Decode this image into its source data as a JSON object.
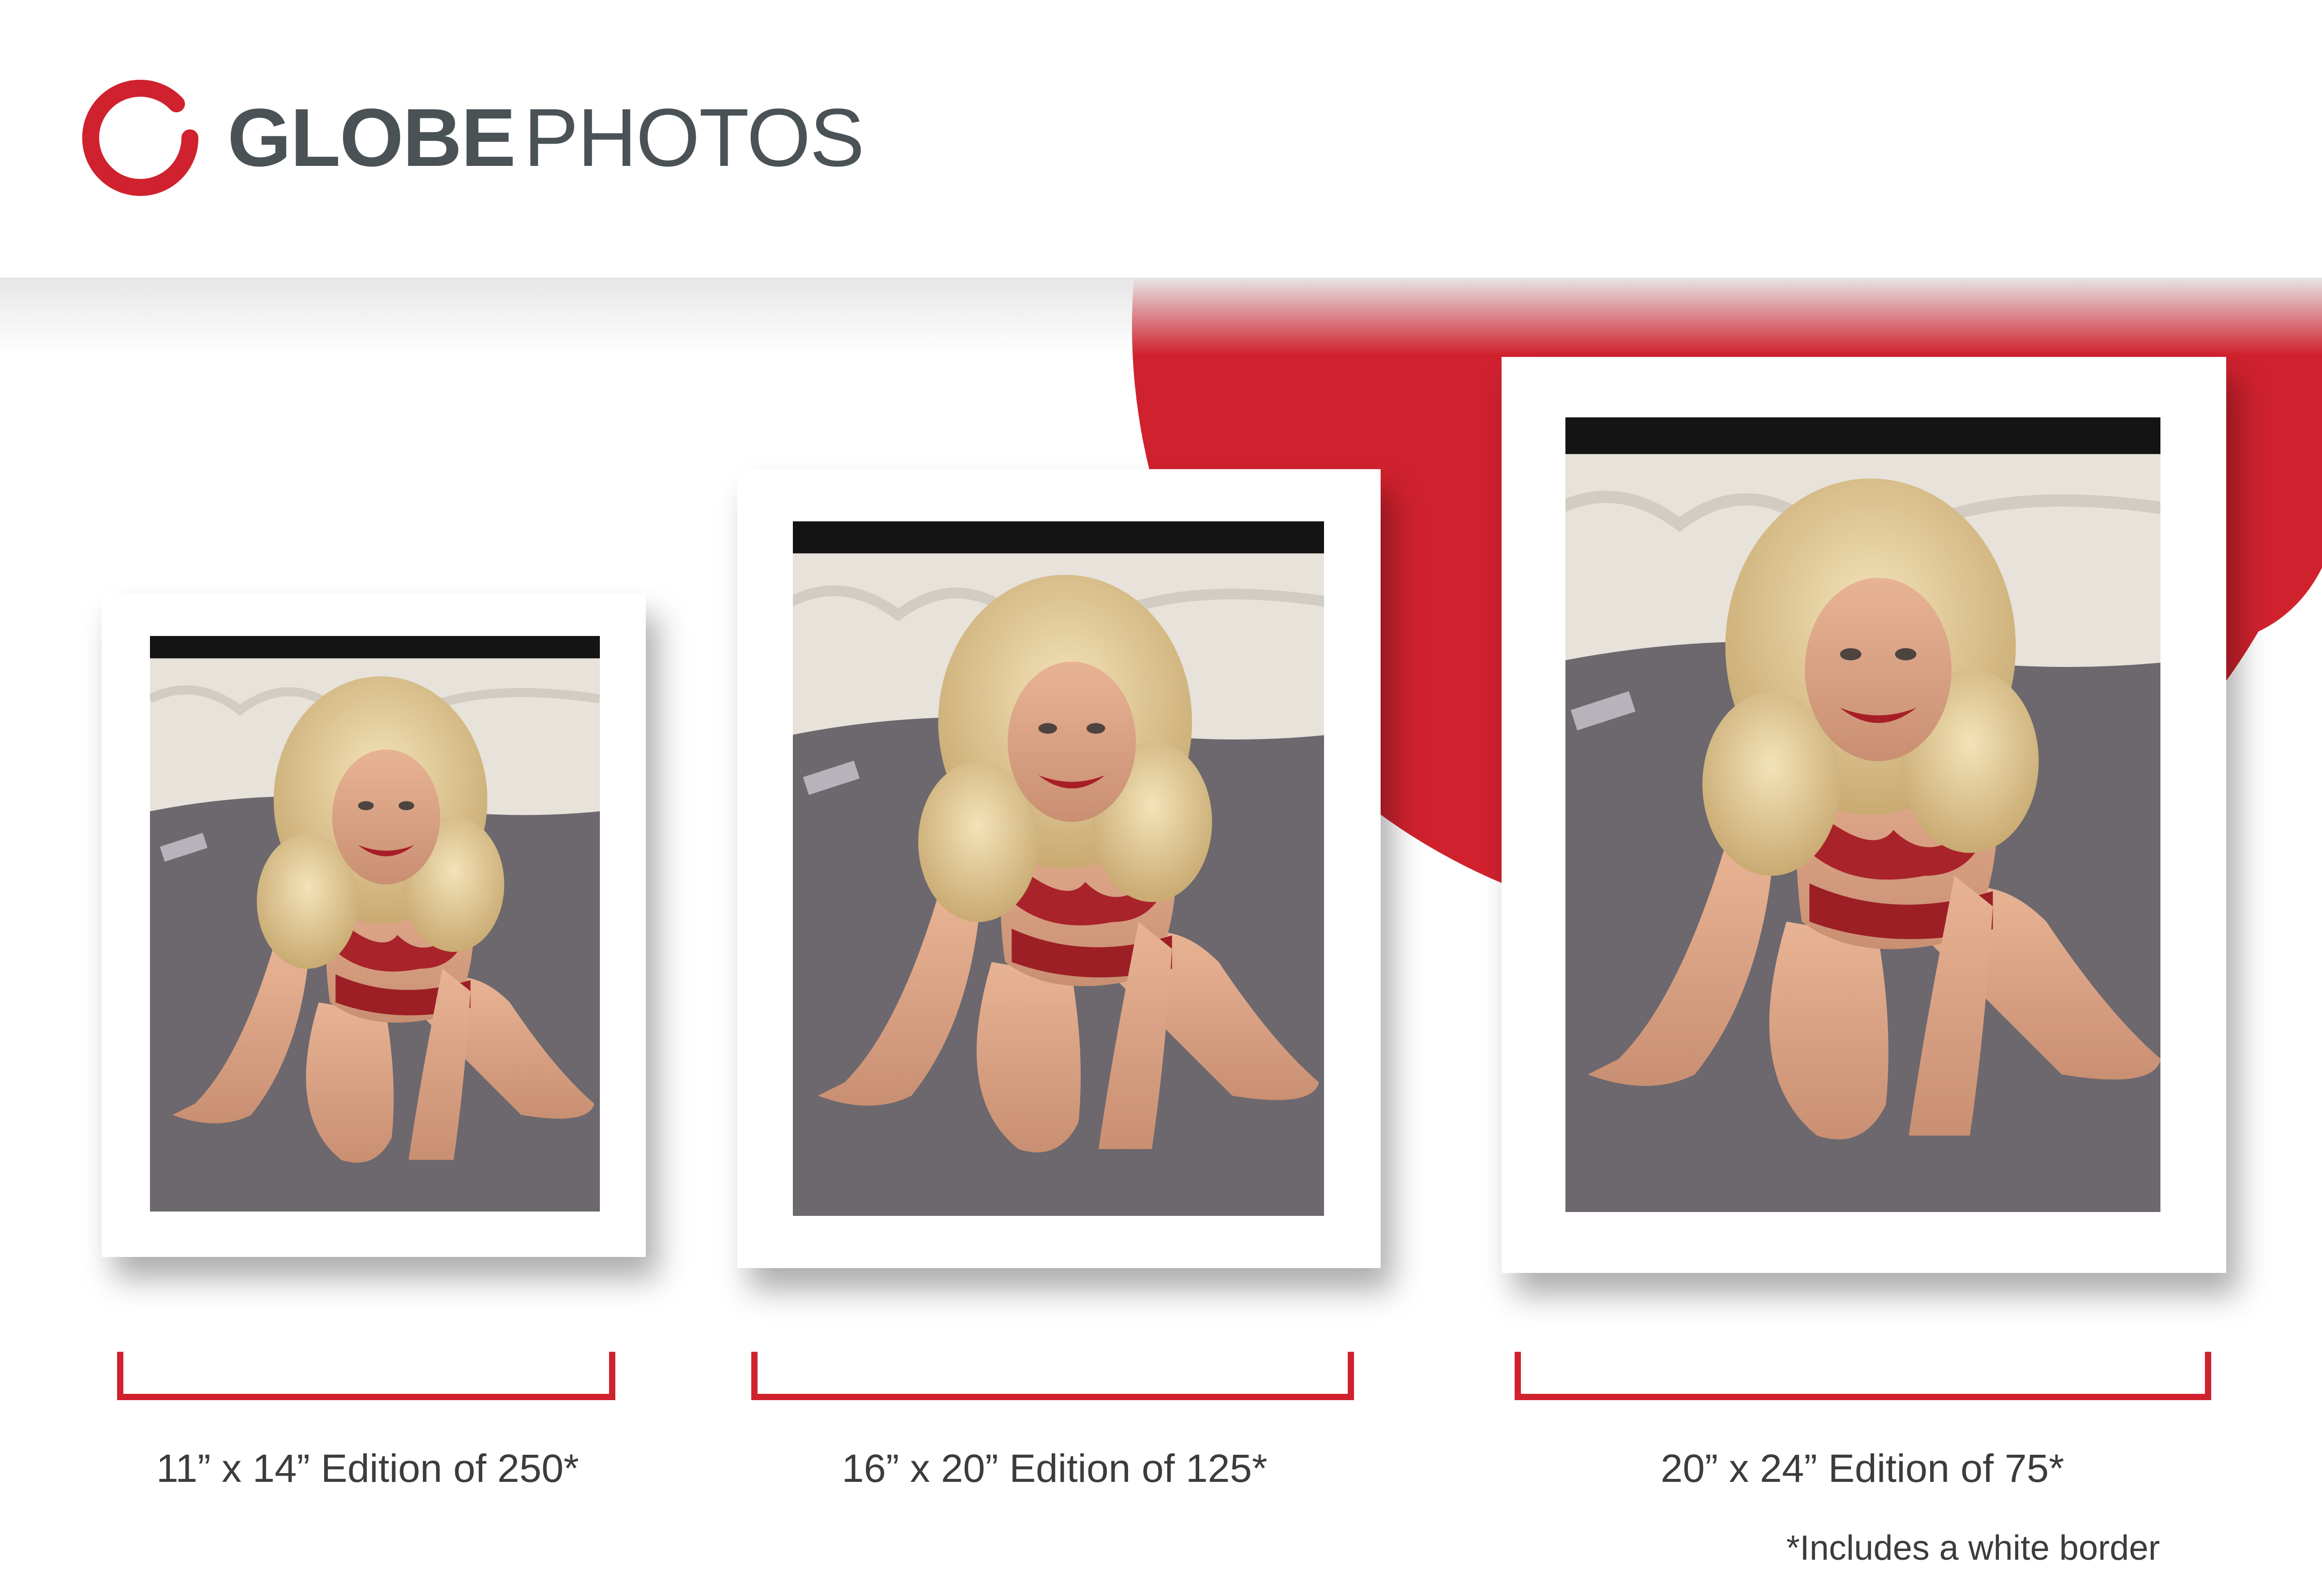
{
  "brand": {
    "name_bold": "GLOBE",
    "name_light": "PHOTOS",
    "logo_icon": "red-brush-ring-icon",
    "accent_color": "#d0222e",
    "text_color": "#4a5256"
  },
  "prints": [
    {
      "size": "11” x 14”",
      "edition": "Edition of 250*",
      "label": "11” x 14” Edition of 250*"
    },
    {
      "size": "16” x 20”",
      "edition": "Edition of 125*",
      "label": "16” x 20” Edition of 125*"
    },
    {
      "size": "20” x 24”",
      "edition": "Edition of 75*",
      "label": "20” x 24” Edition of 75*"
    }
  ],
  "footnote": "*Includes a white border"
}
